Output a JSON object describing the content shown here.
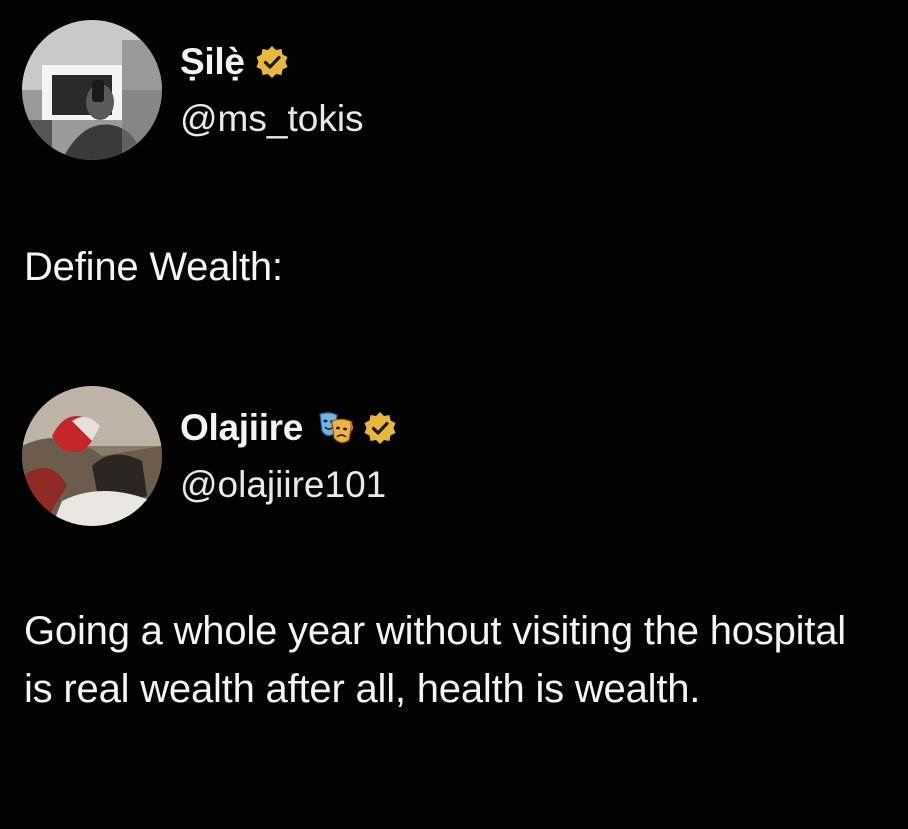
{
  "posts": [
    {
      "author": {
        "display_name": "Ṣilẹ̀",
        "handle": "@ms_tokis",
        "verified": true,
        "avatar_icon": "avatar-photo-bw"
      },
      "text": "Define Wealth:"
    },
    {
      "author": {
        "display_name": "Olajiire",
        "handle": "@olajiire101",
        "verified": true,
        "name_emoji": "performing-arts-emoji",
        "avatar_icon": "avatar-photo-color"
      },
      "text": "Going a whole year without visiting the hospital is real wealth after all, health is wealth."
    }
  ],
  "colors": {
    "background": "#030303",
    "text": "#f5f5f5",
    "verified_badge": "#e8b83a"
  }
}
